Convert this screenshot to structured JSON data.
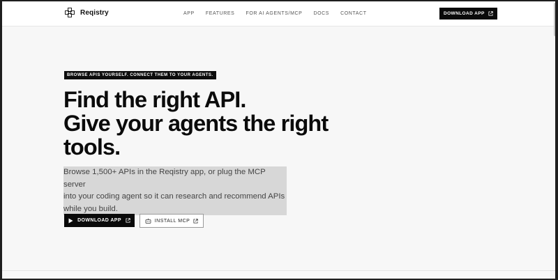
{
  "header": {
    "logo_icon": "crossed-squares-icon",
    "brand": "Reqistry",
    "nav": [
      {
        "label": "APP"
      },
      {
        "label": "FEATURES"
      },
      {
        "label": "FOR AI AGENTS/MCP"
      },
      {
        "label": "DOCS"
      },
      {
        "label": "CONTACT"
      }
    ],
    "download_label": "DOWNLOAD APP",
    "download_icon": "external-link-icon"
  },
  "hero": {
    "eyebrow": "BROWSE APIS YOURSELF. CONNECT THEM TO YOUR AGENTS.",
    "headline_lines": [
      "Find the right API.",
      "Give your agents the right",
      "tools."
    ],
    "lede_lines": [
      "Browse 1,500+ APIs in the Reqistry app, or plug the MCP server",
      "into your coding agent so it can research and recommend APIs",
      "while you build."
    ],
    "primary_button": {
      "label": "DOWNLOAD APP",
      "icon": "play-icon",
      "trailing_icon": "external-link-icon"
    },
    "secondary_button": {
      "label": "INSTALL MCP",
      "icon": "robot-icon",
      "trailing_icon": "external-link-icon"
    }
  },
  "colors": {
    "background": "#f7f7f7",
    "accent": "#0a0a0a",
    "highlight": "#d7d7d7"
  }
}
